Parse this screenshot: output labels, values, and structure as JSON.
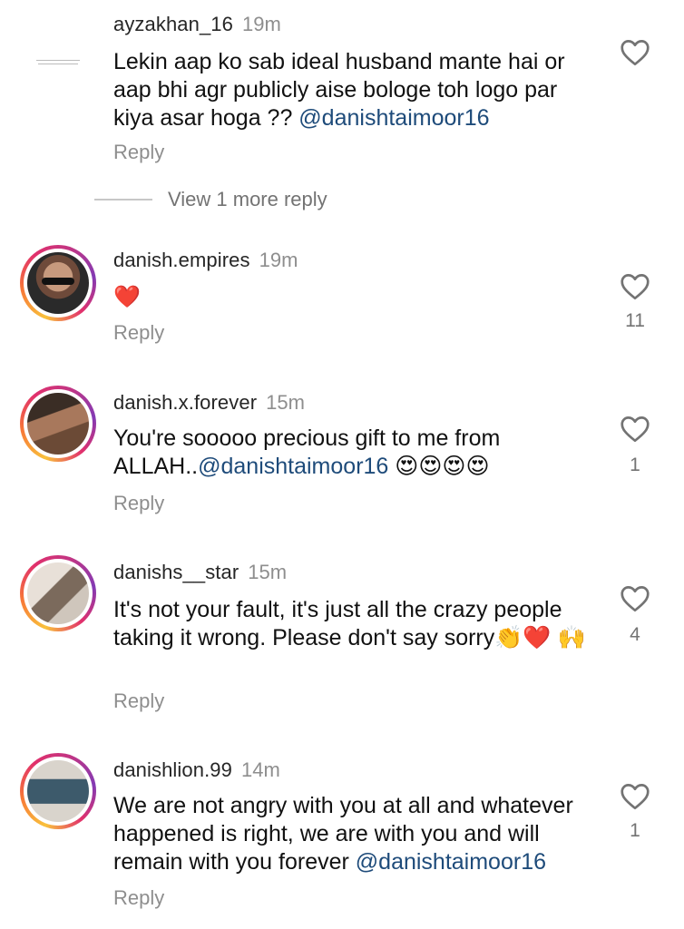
{
  "comments": [
    {
      "username": "ayzakhan_16",
      "time": "19m",
      "text_plain": "Lekin aap ko sab ideal husband mante hai or aap bhi agr publicly aise bologe toh logo par kiya asar hoga ?? ",
      "mention": "@danishtaimoor16",
      "reply": "Reply",
      "likes": ""
    },
    {
      "username": "danish.empires",
      "time": "19m",
      "text_plain": "❤️",
      "mention": "",
      "reply": "Reply",
      "likes": "11"
    },
    {
      "username": "danish.x.forever",
      "time": "15m",
      "text_plain": "You're sooooo precious gift to me from ALLAH..",
      "mention": "@danishtaimoor16",
      "text_after": " 😍😍😍😍",
      "reply": "Reply",
      "likes": "1"
    },
    {
      "username": "danishs__star",
      "time": "15m",
      "text_plain": "It's not your fault, it's just all the crazy people taking it wrong. Please don't say sorry👏❤️ 🙌",
      "mention": "",
      "reply": "Reply",
      "likes": "4"
    },
    {
      "username": "danishlion.99",
      "time": "14m",
      "text_plain": "We are not angry with you at all and whatever happened is right, we are with you and will remain with you forever ",
      "mention": "@danishtaimoor16",
      "reply": "Reply",
      "likes": "1"
    }
  ],
  "view_more_replies": "View 1 more reply",
  "icons": {
    "like": "heart-outline-icon"
  },
  "colors": {
    "mention": "#1e4b7a",
    "meta": "#8e8e8e"
  }
}
